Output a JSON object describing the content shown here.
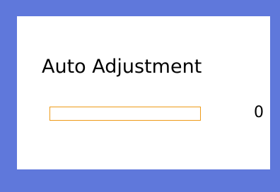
{
  "dialog": {
    "title": "Auto Adjustment",
    "progress": {
      "value_text": "0",
      "percent": 0,
      "bar_color": "#ee9a16"
    }
  },
  "colors": {
    "frame": "#5f78db",
    "panel": "#ffffff",
    "text": "#000000"
  }
}
